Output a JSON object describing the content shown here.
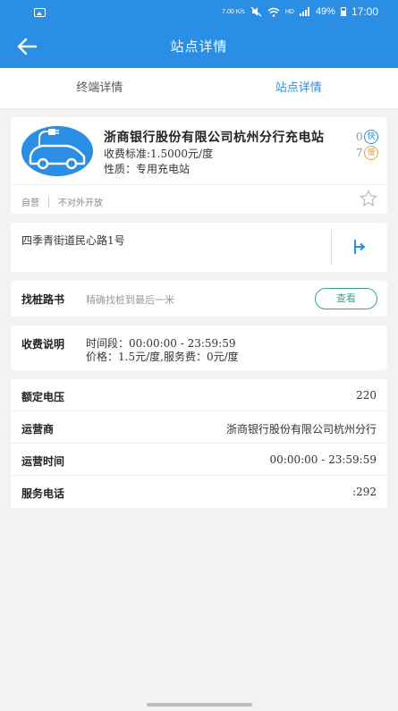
{
  "status_bar": {
    "network_speed": "7.00 K/s",
    "net_type": "HD",
    "battery": "49%",
    "time": "17:00"
  },
  "header": {
    "title": "站点详情"
  },
  "tabs": [
    {
      "label": "终端详情",
      "active": false
    },
    {
      "label": "站点详情",
      "active": true
    }
  ],
  "station": {
    "name": "浙商银行股份有限公司杭州分行充电站",
    "fee_standard": "收费标准:1.5000元/度",
    "nature": "性质：专用充电站",
    "fast_count": "0",
    "fast_badge": "快",
    "slow_count": "7",
    "slow_badge": "慢",
    "operation": "自营",
    "openness": "不对外开放"
  },
  "address": {
    "text": "四季青街道民心路1号"
  },
  "finder": {
    "label": "找桩路书",
    "hint": "精确找桩到最后一米",
    "button": "查看"
  },
  "fee_info": {
    "label": "收费说明",
    "period": "时间段：00:00:00 - 23:59:59",
    "price": "价格：1.5元/度,服务费：0元/度"
  },
  "details": {
    "rated_voltage_label": "额定电压",
    "rated_voltage": "220",
    "operator_label": "运营商",
    "operator": "浙商银行股份有限公司杭州分行",
    "hours_label": "运营时间",
    "hours": "00:00:00 - 23:59:59",
    "phone_label": "服务电话",
    "phone": ":292"
  },
  "colors": {
    "brand": "#2a8ee5",
    "button_accent": "#3aa58c",
    "slow_accent": "#e0a050"
  },
  "icons": [
    "picture-icon",
    "back-arrow-icon",
    "ev-charger-logo",
    "star-icon",
    "navigation-icon"
  ]
}
